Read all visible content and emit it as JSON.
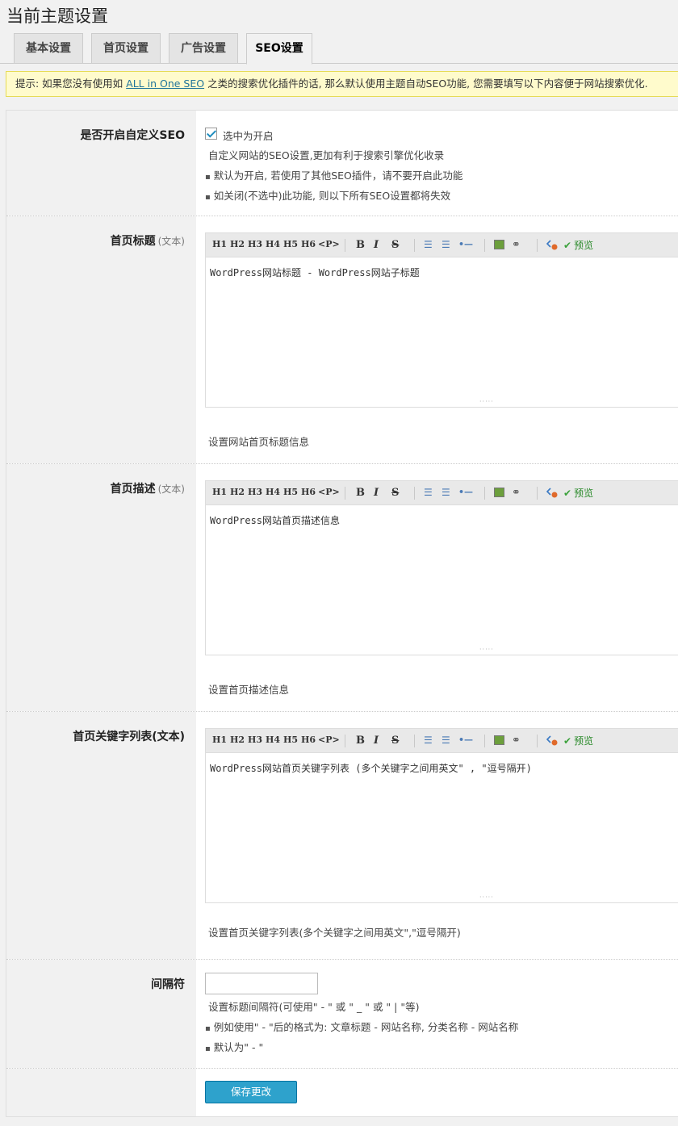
{
  "page": {
    "title": "当前主题设置"
  },
  "tabs": [
    {
      "label": "基本设置",
      "active": false
    },
    {
      "label": "首页设置",
      "active": false
    },
    {
      "label": "广告设置",
      "active": false
    },
    {
      "label": "SEO设置",
      "active": true
    }
  ],
  "notice": {
    "prefix": "提示: 如果您没有使用如 ",
    "link": "ALL in One SEO",
    "suffix": " 之类的搜索优化插件的话, 那么默认使用主题自动SEO功能, 您需要填写以下内容便于网站搜索优化."
  },
  "toolbar": {
    "h1": "H1",
    "h2": "H2",
    "h3": "H3",
    "h4": "H4",
    "h5": "H5",
    "h6": "H6",
    "p": "<P>",
    "bold": "B",
    "italic": "I",
    "strike": "S",
    "ul": "☰",
    "ol": "☰",
    "hr": "•—",
    "link_icon": "⚭",
    "preview": "预览",
    "check": "✔"
  },
  "seo_enable": {
    "label": "是否开启自定义SEO",
    "checkbox_label": "选中为开启",
    "checked": true,
    "desc": "自定义网站的SEO设置,更加有利于搜索引擎优化收录",
    "notes": [
      "默认为开启, 若使用了其他SEO插件，请不要开启此功能",
      "如关闭(不选中)此功能, 则以下所有SEO设置都将失效"
    ]
  },
  "home_title": {
    "label": "首页标题",
    "label_small": "(文本)",
    "value": "WordPress网站标题 - WordPress网站子标题",
    "desc": "设置网站首页标题信息"
  },
  "home_desc": {
    "label": "首页描述",
    "label_small": "(文本)",
    "value": "WordPress网站首页描述信息",
    "desc": "设置首页描述信息"
  },
  "home_keywords": {
    "label": "首页关键字列表(文本)",
    "value": "WordPress网站首页关键字列表 (多个关键字之间用英文\" , \"逗号隔开)",
    "desc": "设置首页关键字列表(多个关键字之间用英文\",\"逗号隔开)"
  },
  "separator": {
    "label": "间隔符",
    "value": "",
    "desc": "设置标题间隔符(可使用\" - \" 或 \" _ \" 或 \" | \"等)",
    "notes": [
      "例如使用\" - \"后的格式为: 文章标题 - 网站名称, 分类名称 - 网站名称",
      "默认为\" - \""
    ]
  },
  "save": {
    "label": "保存更改"
  },
  "colors": {
    "accent": "#2ea2cc",
    "notice_bg": "#fffbcc",
    "link": "#21759b"
  }
}
